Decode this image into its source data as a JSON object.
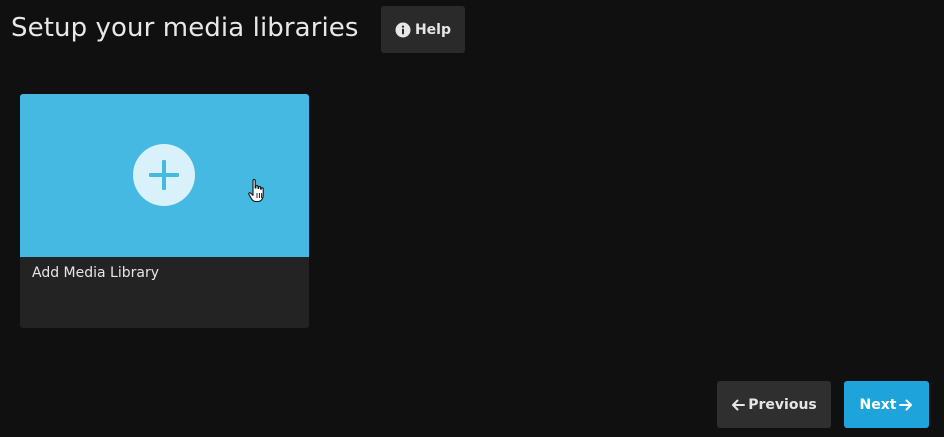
{
  "header": {
    "title": "Setup your media libraries",
    "help_label": "Help",
    "help_icon": "info-icon"
  },
  "library_card": {
    "label": "Add Media Library",
    "icon": "add-icon",
    "accent_color": "#45b9e1"
  },
  "navigation": {
    "previous_label": "Previous",
    "previous_icon": "arrow-left-icon",
    "next_label": "Next",
    "next_icon": "arrow-right-icon",
    "next_color": "#1ea3db"
  }
}
